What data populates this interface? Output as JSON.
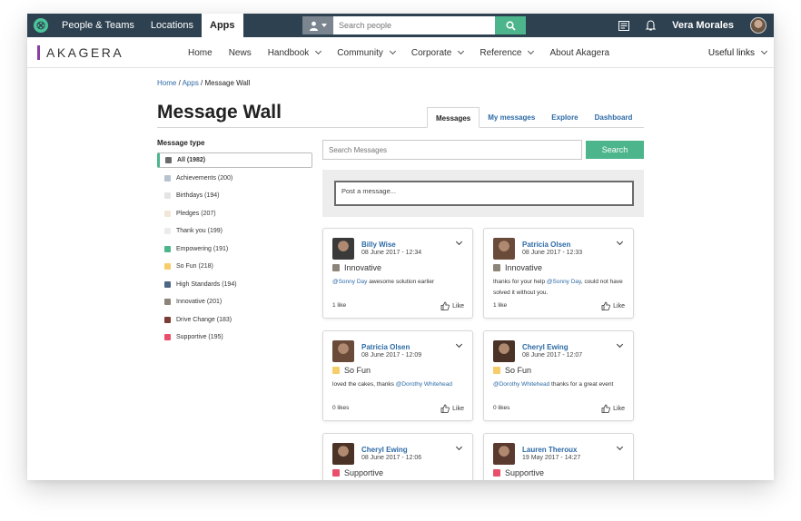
{
  "topbar": {
    "nav": [
      "People & Teams",
      "Locations",
      "Apps"
    ],
    "active_nav": "Apps",
    "search_placeholder": "Search people",
    "user_name": "Vera Morales"
  },
  "brand": {
    "name": "AKAGERA",
    "bar_color": "#8b3fa0"
  },
  "secnav": {
    "items": [
      {
        "label": "Home",
        "dropdown": false
      },
      {
        "label": "News",
        "dropdown": false
      },
      {
        "label": "Handbook",
        "dropdown": true
      },
      {
        "label": "Community",
        "dropdown": true
      },
      {
        "label": "Corporate",
        "dropdown": true
      },
      {
        "label": "Reference",
        "dropdown": true
      },
      {
        "label": "About Akagera",
        "dropdown": false
      }
    ],
    "useful_links": "Useful links"
  },
  "breadcrumb": {
    "home": "Home",
    "apps": "Apps",
    "current": "Message Wall"
  },
  "page_title": "Message Wall",
  "tabs": [
    "Messages",
    "My messages",
    "Explore",
    "Dashboard"
  ],
  "active_tab": "Messages",
  "filter_title": "Message type",
  "filters": [
    {
      "label": "All (1982)",
      "color": "#6b6b6b",
      "active": true
    },
    {
      "label": "Achievements (200)",
      "color": "#b7c3cf"
    },
    {
      "label": "Birthdays (194)",
      "color": "#e4e4e4"
    },
    {
      "label": "Pledges (207)",
      "color": "#f1e6d7"
    },
    {
      "label": "Thank you (199)",
      "color": "#ececec"
    },
    {
      "label": "Empowering (191)",
      "color": "#4cb58c"
    },
    {
      "label": "So Fun (218)",
      "color": "#f7cd6a"
    },
    {
      "label": "High Standards (194)",
      "color": "#4e6685"
    },
    {
      "label": "Innovative (201)",
      "color": "#8c8478"
    },
    {
      "label": "Drive Change (183)",
      "color": "#7a3c34"
    },
    {
      "label": "Supportive (195)",
      "color": "#e94e6a"
    }
  ],
  "search_messages_placeholder": "Search Messages",
  "search_button": "Search",
  "post_placeholder": "Post a message...",
  "like_label": "Like",
  "cards": [
    {
      "name": "Billy Wise",
      "date": "08 June 2017 - 12:34",
      "type": "Innovative",
      "type_color": "#8c8478",
      "text_mention": "@Sonny Day",
      "text": " awesome solution earlier",
      "likes": "1 like",
      "avatar": "#3a3a3a"
    },
    {
      "name": "Patricia Olsen",
      "date": "08 June 2017 - 12:33",
      "type": "Innovative",
      "type_color": "#8c8478",
      "text_prefix": "thanks for your help ",
      "text_mention": "@Sonny Day",
      "text": ", could not have solved it without you.",
      "likes": "1 like",
      "avatar": "#6a4b3a"
    },
    {
      "name": "Patricia Olsen",
      "date": "08 June 2017 - 12:09",
      "type": "So Fun",
      "type_color": "#f7cd6a",
      "text_prefix": "loved the cakes, thanks ",
      "text_mention": "@Dorothy Whitehead",
      "text": "",
      "likes": "0 likes",
      "avatar": "#6a4b3a"
    },
    {
      "name": "Cheryl Ewing",
      "date": "08 June 2017 - 12:07",
      "type": "So Fun",
      "type_color": "#f7cd6a",
      "text_mention": "@Dorothy Whitehead",
      "text": " thanks for a great event",
      "likes": "0 likes",
      "avatar": "#4a3326"
    },
    {
      "name": "Cheryl Ewing",
      "date": "08 June 2017 - 12:06",
      "type": "Supportive",
      "type_color": "#e94e6a",
      "avatar": "#4a3326"
    },
    {
      "name": "Lauren Theroux",
      "date": "19 May 2017 - 14:27",
      "type": "Supportive",
      "type_color": "#e94e6a",
      "avatar": "#5a3a2e"
    }
  ]
}
